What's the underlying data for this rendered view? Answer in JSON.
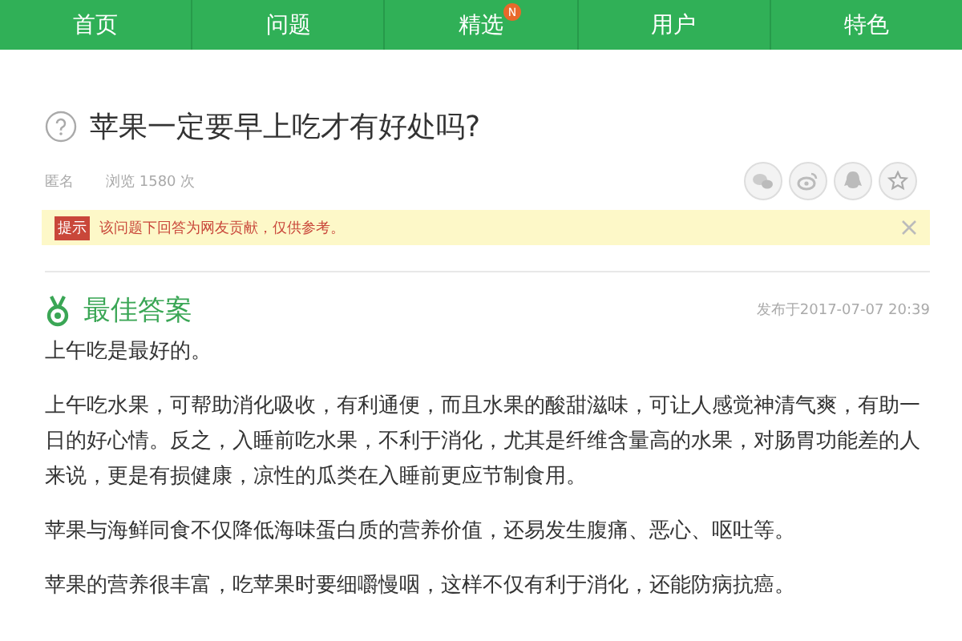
{
  "nav": [
    {
      "label": "首页"
    },
    {
      "label": "问题"
    },
    {
      "label": "精选",
      "badge": "N"
    },
    {
      "label": "用户"
    },
    {
      "label": "特色"
    }
  ],
  "question": {
    "title": "苹果一定要早上吃才有好处吗?",
    "author": "匿名",
    "views": "浏览 1580 次"
  },
  "notice": {
    "tag": "提示",
    "text": "该问题下回答为网友贡献，仅供参考。"
  },
  "answer": {
    "heading": "最佳答案",
    "date": "发布于2017-07-07 20:39",
    "paragraphs": [
      "上午吃是最好的。",
      "上午吃水果，可帮助消化吸收，有利通便，而且水果的酸甜滋味，可让人感觉神清气爽，有助一日的好心情。反之，入睡前吃水果，不利于消化，尤其是纤维含量高的水果，对肠胃功能差的人来说，更是有损健康，凉性的瓜类在入睡前更应节制食用。",
      "苹果与海鲜同食不仅降低海味蛋白质的营养价值，还易发生腹痛、恶心、呕吐等。",
      "苹果的营养很丰富，吃苹果时要细嚼慢咽，这样不仅有利于消化，还能防病抗癌。"
    ]
  }
}
